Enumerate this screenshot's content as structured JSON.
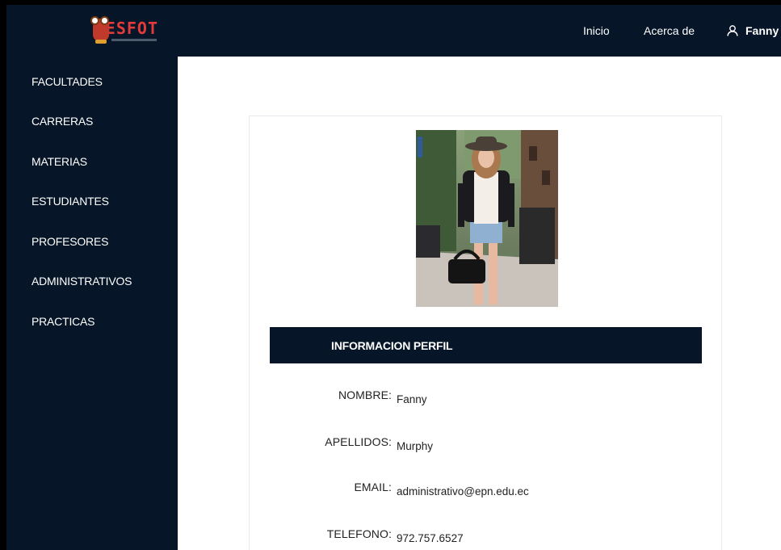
{
  "brand": {
    "logo_text": "ESFOT"
  },
  "topnav": {
    "inicio": "Inicio",
    "acerca": "Acerca de",
    "user": "Fanny"
  },
  "sidebar": {
    "items": [
      {
        "label": "FACULTADES"
      },
      {
        "label": "CARRERAS"
      },
      {
        "label": "MATERIAS"
      },
      {
        "label": "ESTUDIANTES"
      },
      {
        "label": "PROFESORES"
      },
      {
        "label": "ADMINISTRATIVOS"
      },
      {
        "label": "PRACTICAS"
      }
    ]
  },
  "profile": {
    "header": "INFORMACION PERFIL",
    "fields": [
      {
        "label": "NOMBRE:",
        "value": "Fanny"
      },
      {
        "label": "APELLIDOS:",
        "value": "Murphy"
      },
      {
        "label": "EMAIL:",
        "value": "administrativo@epn.edu.ec"
      },
      {
        "label": "TELEFONO:",
        "value": "972.757.6527"
      }
    ]
  },
  "colors": {
    "navy": "#061527",
    "logo_red": "#e23b3b"
  },
  "icons": {
    "user": "user-icon",
    "logo": "owl-logo-icon"
  }
}
